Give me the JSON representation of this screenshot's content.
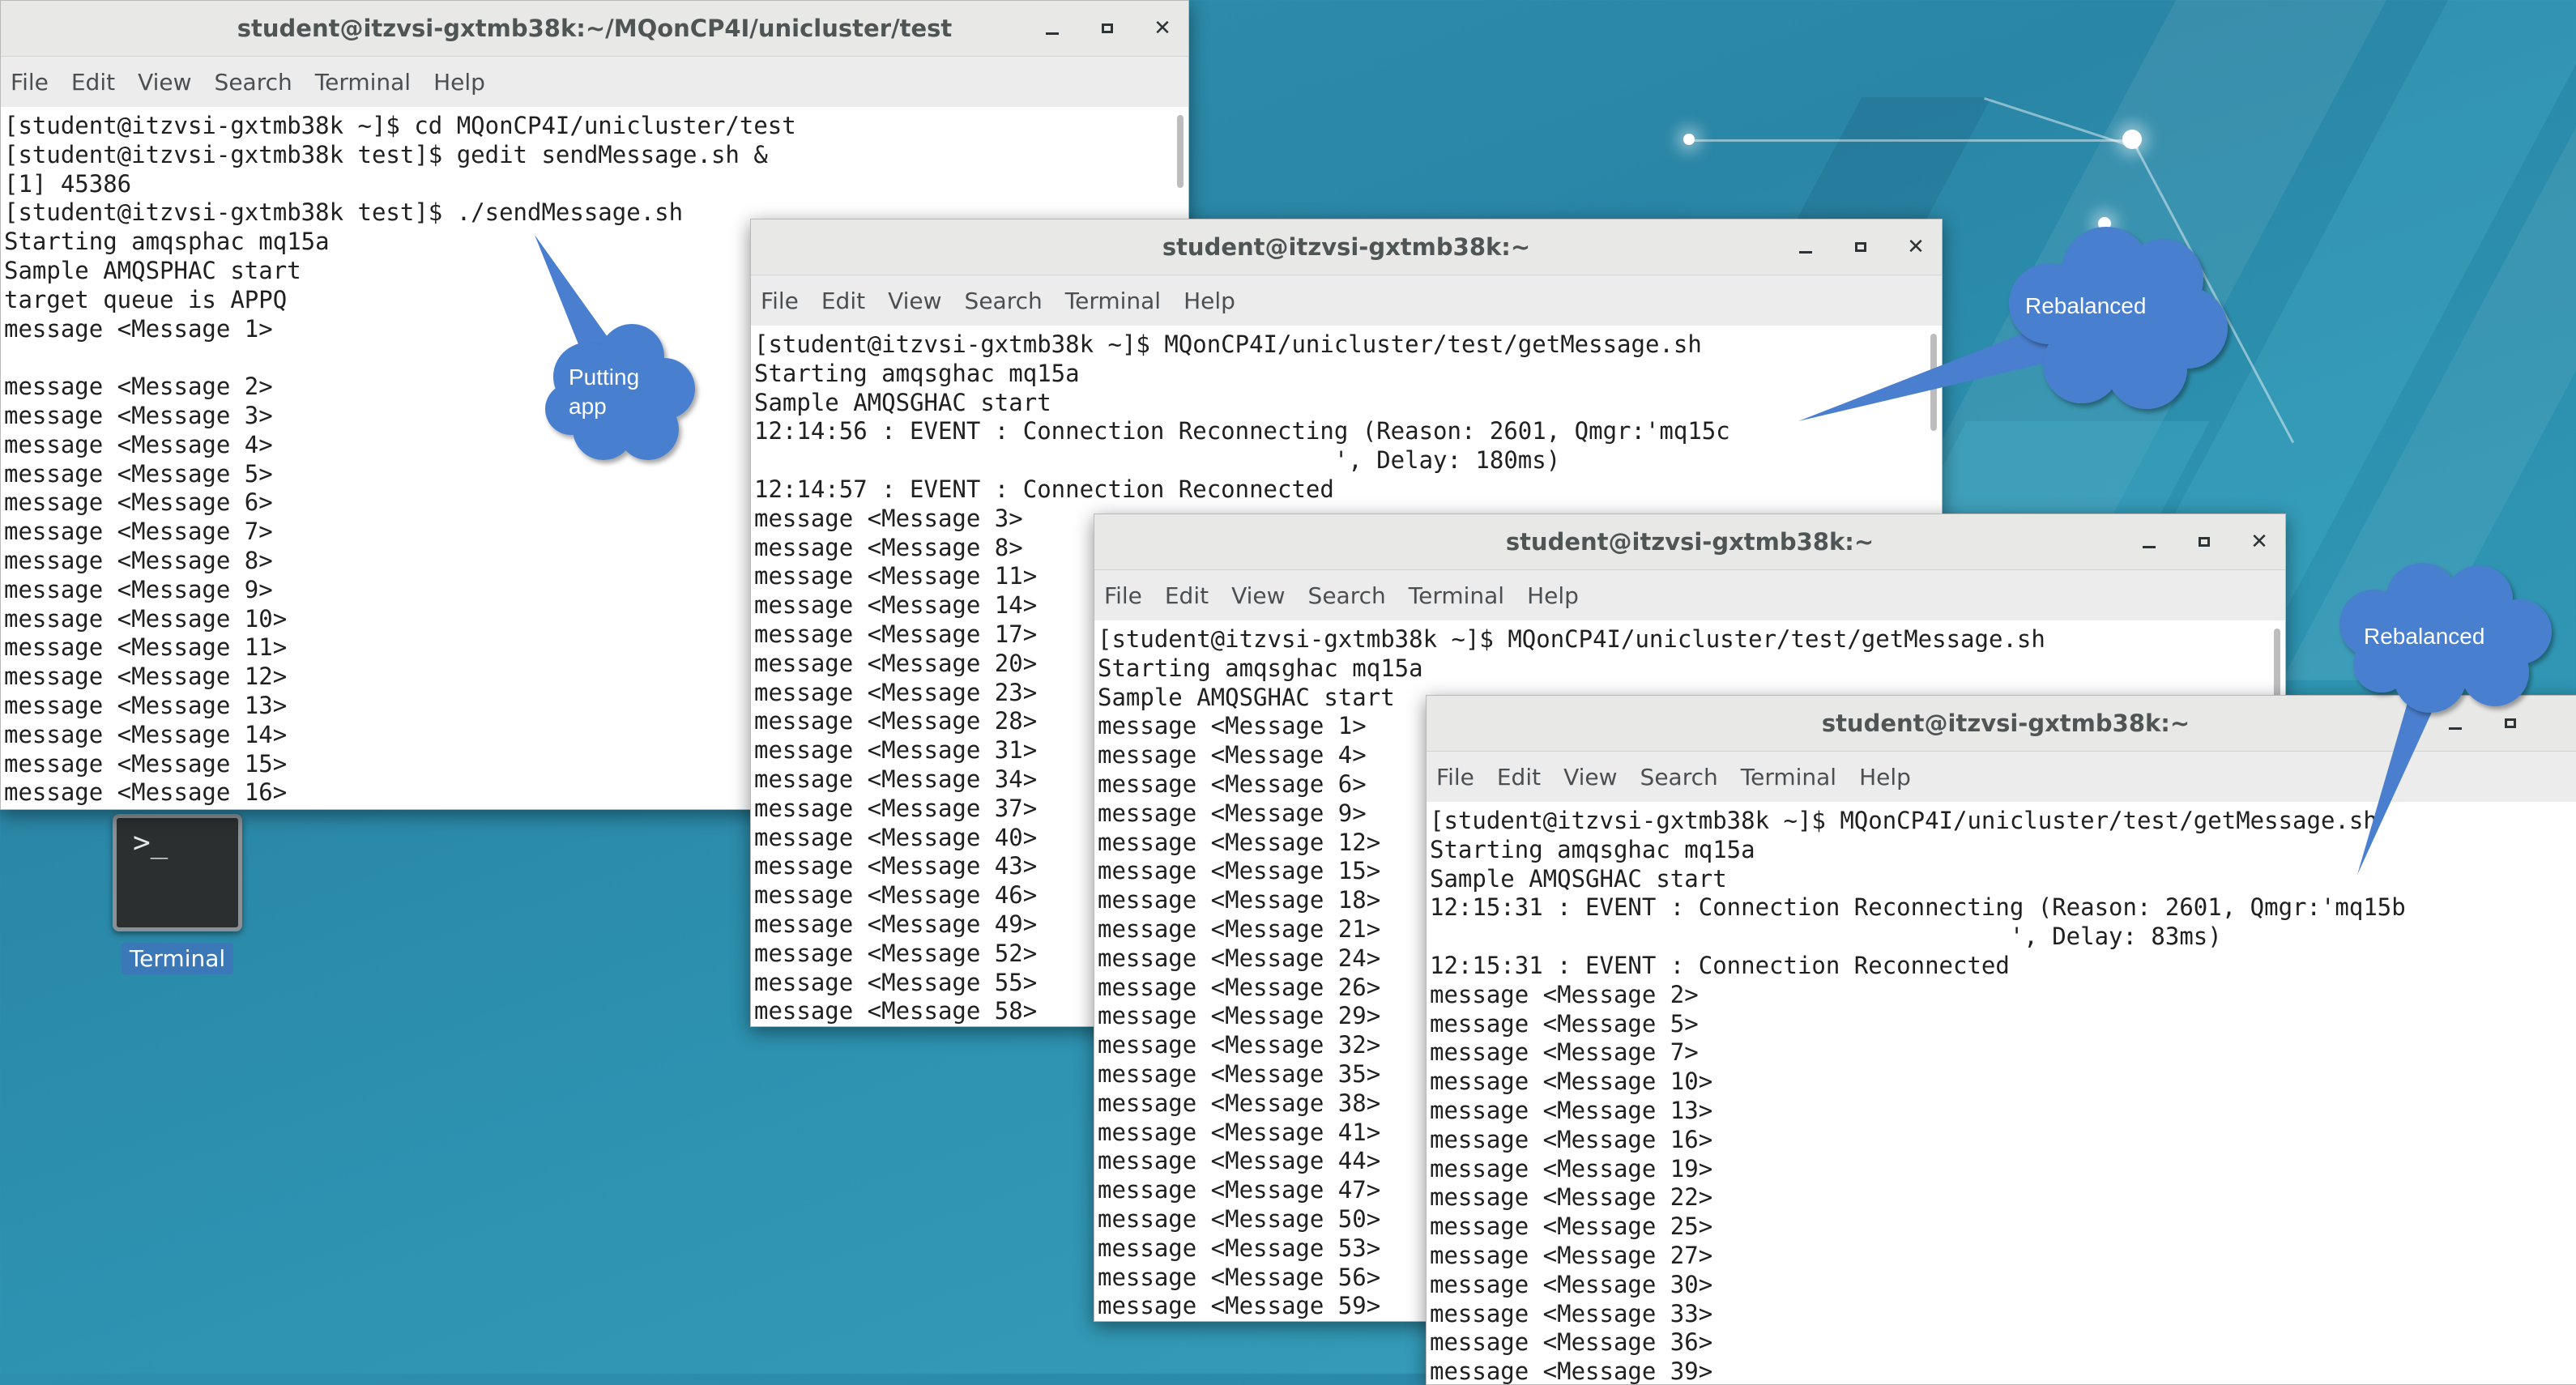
{
  "desktop": {
    "icon_label": "Terminal",
    "accent": "#3a78b7",
    "callout_color": "#4a7fcf"
  },
  "menu": [
    "File",
    "Edit",
    "View",
    "Search",
    "Terminal",
    "Help"
  ],
  "windows": {
    "w1": {
      "title": "student@itzvsi-gxtmb38k:~/MQonCP4I/unicluster/test",
      "lines": [
        "[student@itzvsi-gxtmb38k ~]$ cd MQonCP4I/unicluster/test",
        "[student@itzvsi-gxtmb38k test]$ gedit sendMessage.sh &",
        "[1] 45386",
        "[student@itzvsi-gxtmb38k test]$ ./sendMessage.sh",
        "Starting amqsphac mq15a",
        "Sample AMQSPHAC start",
        "target queue is APPQ",
        "message <Message 1>",
        "",
        "message <Message 2>",
        "message <Message 3>",
        "message <Message 4>",
        "message <Message 5>",
        "message <Message 6>",
        "message <Message 7>",
        "message <Message 8>",
        "message <Message 9>",
        "message <Message 10>",
        "message <Message 11>",
        "message <Message 12>",
        "message <Message 13>",
        "message <Message 14>",
        "message <Message 15>",
        "message <Message 16>"
      ]
    },
    "w2": {
      "title": "student@itzvsi-gxtmb38k:~",
      "lines": [
        "[student@itzvsi-gxtmb38k ~]$ MQonCP4I/unicluster/test/getMessage.sh",
        "Starting amqsghac mq15a",
        "Sample AMQSGHAC start",
        "12:14:56 : EVENT : Connection Reconnecting (Reason: 2601, Qmgr:'mq15c",
        "                                         ', Delay: 180ms)",
        "12:14:57 : EVENT : Connection Reconnected",
        "message <Message 3>",
        "message <Message 8>",
        "message <Message 11>",
        "message <Message 14>",
        "message <Message 17>",
        "message <Message 20>",
        "message <Message 23>",
        "message <Message 28>",
        "message <Message 31>",
        "message <Message 34>",
        "message <Message 37>",
        "message <Message 40>",
        "message <Message 43>",
        "message <Message 46>",
        "message <Message 49>",
        "message <Message 52>",
        "message <Message 55>",
        "message <Message 58>"
      ]
    },
    "w3": {
      "title": "student@itzvsi-gxtmb38k:~",
      "lines": [
        "[student@itzvsi-gxtmb38k ~]$ MQonCP4I/unicluster/test/getMessage.sh",
        "Starting amqsghac mq15a",
        "Sample AMQSGHAC start",
        "message <Message 1>",
        "message <Message 4>",
        "message <Message 6>",
        "message <Message 9>",
        "message <Message 12>",
        "message <Message 15>",
        "message <Message 18>",
        "message <Message 21>",
        "message <Message 24>",
        "message <Message 26>",
        "message <Message 29>",
        "message <Message 32>",
        "message <Message 35>",
        "message <Message 38>",
        "message <Message 41>",
        "message <Message 44>",
        "message <Message 47>",
        "message <Message 50>",
        "message <Message 53>",
        "message <Message 56>",
        "message <Message 59>"
      ]
    },
    "w4": {
      "title": "student@itzvsi-gxtmb38k:~",
      "lines": [
        "[student@itzvsi-gxtmb38k ~]$ MQonCP4I/unicluster/test/getMessage.sh",
        "Starting amqsghac mq15a",
        "Sample AMQSGHAC start",
        "12:15:31 : EVENT : Connection Reconnecting (Reason: 2601, Qmgr:'mq15b",
        "                                         ', Delay: 83ms)",
        "12:15:31 : EVENT : Connection Reconnected",
        "message <Message 2>",
        "message <Message 5>",
        "message <Message 7>",
        "message <Message 10>",
        "message <Message 13>",
        "message <Message 16>",
        "message <Message 19>",
        "message <Message 22>",
        "message <Message 25>",
        "message <Message 27>",
        "message <Message 30>",
        "message <Message 33>",
        "message <Message 36>",
        "message <Message 39>"
      ]
    }
  },
  "callouts": {
    "putting": "Putting app",
    "rebalanced1": "Rebalanced",
    "rebalanced2": "Rebalanced"
  }
}
